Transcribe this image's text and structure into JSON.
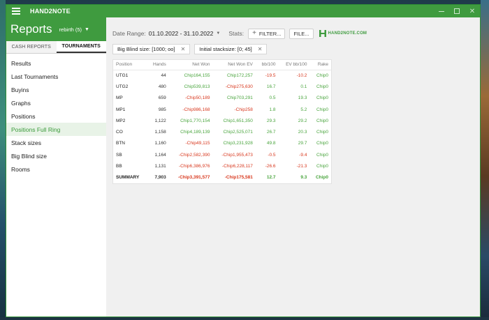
{
  "app": {
    "title": "HAND2NOTE"
  },
  "header": {
    "title": "Reports",
    "profile": "rebirth (5)"
  },
  "tabs": [
    {
      "label": "CASH REPORTS",
      "active": false
    },
    {
      "label": "TOURNAMENTS",
      "active": true
    }
  ],
  "menu": [
    {
      "label": "Results",
      "active": false
    },
    {
      "label": "Last Tournaments",
      "active": false
    },
    {
      "label": "Buyins",
      "active": false
    },
    {
      "label": "Graphs",
      "active": false
    },
    {
      "label": "Positions",
      "active": false
    },
    {
      "label": "Positions Full Ring",
      "active": true
    },
    {
      "label": "Stack sizes",
      "active": false
    },
    {
      "label": "Big Blind size",
      "active": false
    },
    {
      "label": "Rooms",
      "active": false
    }
  ],
  "toolbar": {
    "date_label": "Date Range:",
    "date_value": "01.10.2022 - 31.10.2022",
    "stats_label": "Stats:",
    "filter_button": "FILTER...",
    "file_button": "FILE...",
    "logo_text": "HAND2NOTE.COM"
  },
  "filters": [
    {
      "label": "Big Blind size: [1000; oo]"
    },
    {
      "label": "Initial stacksize: [0; 45]"
    }
  ],
  "table": {
    "columns": [
      "Position",
      "Hands",
      "Net Won",
      "Net Won EV",
      "bb/100",
      "EV bb/100",
      "Rake"
    ],
    "rows": [
      {
        "position": "UTG1",
        "hands": "44",
        "net_won": "Chip164,155",
        "net_won_ev": "Chip172,257",
        "bb100": "-19.5",
        "ev_bb100": "-10.2",
        "rake": "Chip0"
      },
      {
        "position": "UTG2",
        "hands": "480",
        "net_won": "Chip539,813",
        "net_won_ev": "-Chip275,630",
        "bb100": "16.7",
        "ev_bb100": "0.1",
        "rake": "Chip0"
      },
      {
        "position": "MP",
        "hands": "659",
        "net_won": "-Chip50,189",
        "net_won_ev": "Chip703,291",
        "bb100": "0.5",
        "ev_bb100": "19.3",
        "rake": "Chip0"
      },
      {
        "position": "MP1",
        "hands": "985",
        "net_won": "-Chip986,168",
        "net_won_ev": "-Chip258",
        "bb100": "1.8",
        "ev_bb100": "5.2",
        "rake": "Chip0"
      },
      {
        "position": "MP2",
        "hands": "1,122",
        "net_won": "Chip1,770,154",
        "net_won_ev": "Chip1,651,350",
        "bb100": "29.3",
        "ev_bb100": "29.2",
        "rake": "Chip0"
      },
      {
        "position": "CO",
        "hands": "1,158",
        "net_won": "Chip4,189,139",
        "net_won_ev": "Chip2,525,071",
        "bb100": "26.7",
        "ev_bb100": "20.3",
        "rake": "Chip0"
      },
      {
        "position": "BTN",
        "hands": "1,160",
        "net_won": "-Chip49,115",
        "net_won_ev": "Chip3,231,928",
        "bb100": "49.8",
        "ev_bb100": "29.7",
        "rake": "Chip0"
      },
      {
        "position": "SB",
        "hands": "1,164",
        "net_won": "-Chip2,582,390",
        "net_won_ev": "-Chip1,955,473",
        "bb100": "-0.5",
        "ev_bb100": "-9.4",
        "rake": "Chip0"
      },
      {
        "position": "BB",
        "hands": "1,131",
        "net_won": "-Chip6,386,976",
        "net_won_ev": "-Chip6,228,117",
        "bb100": "-26.6",
        "ev_bb100": "-21.3",
        "rake": "Chip0"
      }
    ],
    "summary": {
      "position": "SUMMARY",
      "hands": "7,903",
      "net_won": "-Chip3,391,577",
      "net_won_ev": "-Chip175,581",
      "bb100": "12.7",
      "ev_bb100": "9.3",
      "rake": "Chip0"
    }
  },
  "colors": {
    "accent": "#3f9b3f",
    "positive": "#4aa53e",
    "negative": "#d8381e"
  }
}
